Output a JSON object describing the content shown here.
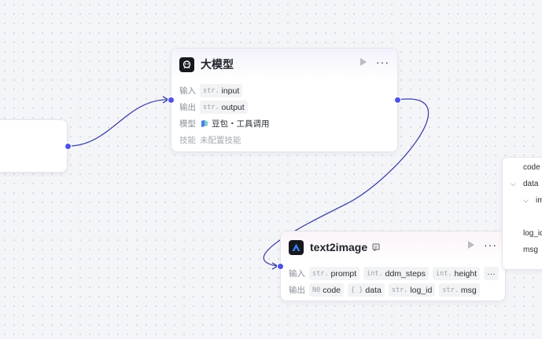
{
  "llm_node": {
    "title": "大模型",
    "icon": "llm-node-icon",
    "input_label": "输入",
    "input_type": "str.",
    "input_name": "input",
    "output_label": "输出",
    "output_type": "str.",
    "output_name": "output",
    "model_label": "模型",
    "model_value": "豆包・工具调用",
    "skill_label": "技能",
    "skill_value": "未配置技能"
  },
  "t2i_node": {
    "title": "text2image",
    "icon": "text2image-node-icon",
    "input_label": "输入",
    "inputs": [
      {
        "type": "str.",
        "name": "prompt"
      },
      {
        "type": "int.",
        "name": "ddm_steps"
      },
      {
        "type": "int.",
        "name": "height"
      }
    ],
    "inputs_more": "···",
    "output_label": "输出",
    "outputs": [
      {
        "type": "N0",
        "name": "code"
      },
      {
        "type": "{ }",
        "name": "data"
      },
      {
        "type": "str.",
        "name": "log_id"
      },
      {
        "type": "str.",
        "name": "msg"
      }
    ]
  },
  "popup": {
    "items": [
      "code",
      "data",
      "im",
      "log_id",
      "msg"
    ]
  },
  "colors": {
    "port": "#4d53e8",
    "edge": "#3f45a8",
    "canvas": "#f4f5f8"
  }
}
